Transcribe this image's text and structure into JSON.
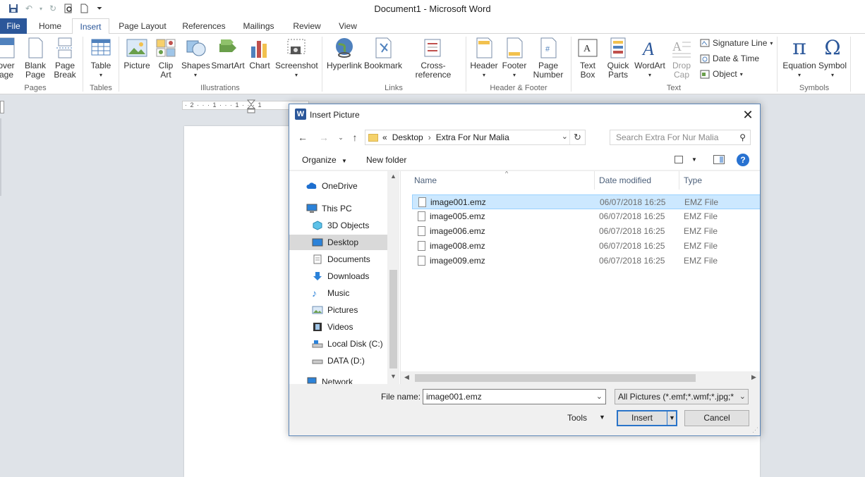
{
  "app": {
    "title": "Document1  -  Microsoft Word",
    "colors": {
      "accent": "#2b579a",
      "selection": "#cce8ff",
      "primary_button_border": "#2a74c9"
    }
  },
  "tabs": [
    "File",
    "Home",
    "Insert",
    "Page Layout",
    "References",
    "Mailings",
    "Review",
    "View"
  ],
  "ribbon": {
    "pages": {
      "cover": "over",
      "cover2": "age",
      "blank": "Blank",
      "blank2": "Page",
      "pagebreak": "Page",
      "pagebreak2": "Break",
      "group": "Pages"
    },
    "tables": {
      "table": "Table",
      "group": "Tables"
    },
    "illustrations": {
      "picture": "Picture",
      "clip": "Clip",
      "clip2": "Art",
      "shapes": "Shapes",
      "smartart": "SmartArt",
      "chart": "Chart",
      "screenshot": "Screenshot",
      "group": "Illustrations"
    },
    "links": {
      "hyperlink": "Hyperlink",
      "bookmark": "Bookmark",
      "crossref": "Cross-reference",
      "group": "Links"
    },
    "headerfooter": {
      "header": "Header",
      "footer": "Footer",
      "pagenum": "Page",
      "pagenum2": "Number",
      "group": "Header & Footer"
    },
    "text": {
      "textbox": "Text",
      "textbox2": "Box",
      "quickparts": "Quick",
      "quickparts2": "Parts",
      "wordart": "WordArt",
      "dropcap": "Drop",
      "dropcap2": "Cap",
      "signature": "Signature Line",
      "datetime": "Date & Time",
      "object": "Object",
      "group": "Text"
    },
    "symbols": {
      "equation": "Equation",
      "symbol": "Symbol",
      "group": "Symbols"
    }
  },
  "ruler_text": "· 2 · · · 1 · · · 1 · · · 1",
  "dialog": {
    "title": "Insert Picture",
    "path": {
      "prefix": "«",
      "crumbs": [
        "Desktop",
        "Extra For Nur Malia"
      ]
    },
    "search_placeholder": "Search Extra For Nur Malia",
    "toolbar": {
      "organize": "Organize",
      "new_folder": "New folder"
    },
    "nav": [
      "OneDrive",
      "This PC",
      "3D Objects",
      "Desktop",
      "Documents",
      "Downloads",
      "Music",
      "Pictures",
      "Videos",
      "Local Disk (C:)",
      "DATA (D:)",
      "Network"
    ],
    "columns": {
      "name": "Name",
      "date": "Date modified",
      "type": "Type"
    },
    "files": [
      {
        "name": "image001.emz",
        "date": "06/07/2018 16:25",
        "type": "EMZ File"
      },
      {
        "name": "image005.emz",
        "date": "06/07/2018 16:25",
        "type": "EMZ File"
      },
      {
        "name": "image006.emz",
        "date": "06/07/2018 16:25",
        "type": "EMZ File"
      },
      {
        "name": "image008.emz",
        "date": "06/07/2018 16:25",
        "type": "EMZ File"
      },
      {
        "name": "image009.emz",
        "date": "06/07/2018 16:25",
        "type": "EMZ File"
      }
    ],
    "file_name_label": "File name:",
    "file_name_value": "image001.emz",
    "filter": "All Pictures (*.emf;*.wmf;*.jpg;*",
    "tools": "Tools",
    "insert": "Insert",
    "cancel": "Cancel"
  }
}
